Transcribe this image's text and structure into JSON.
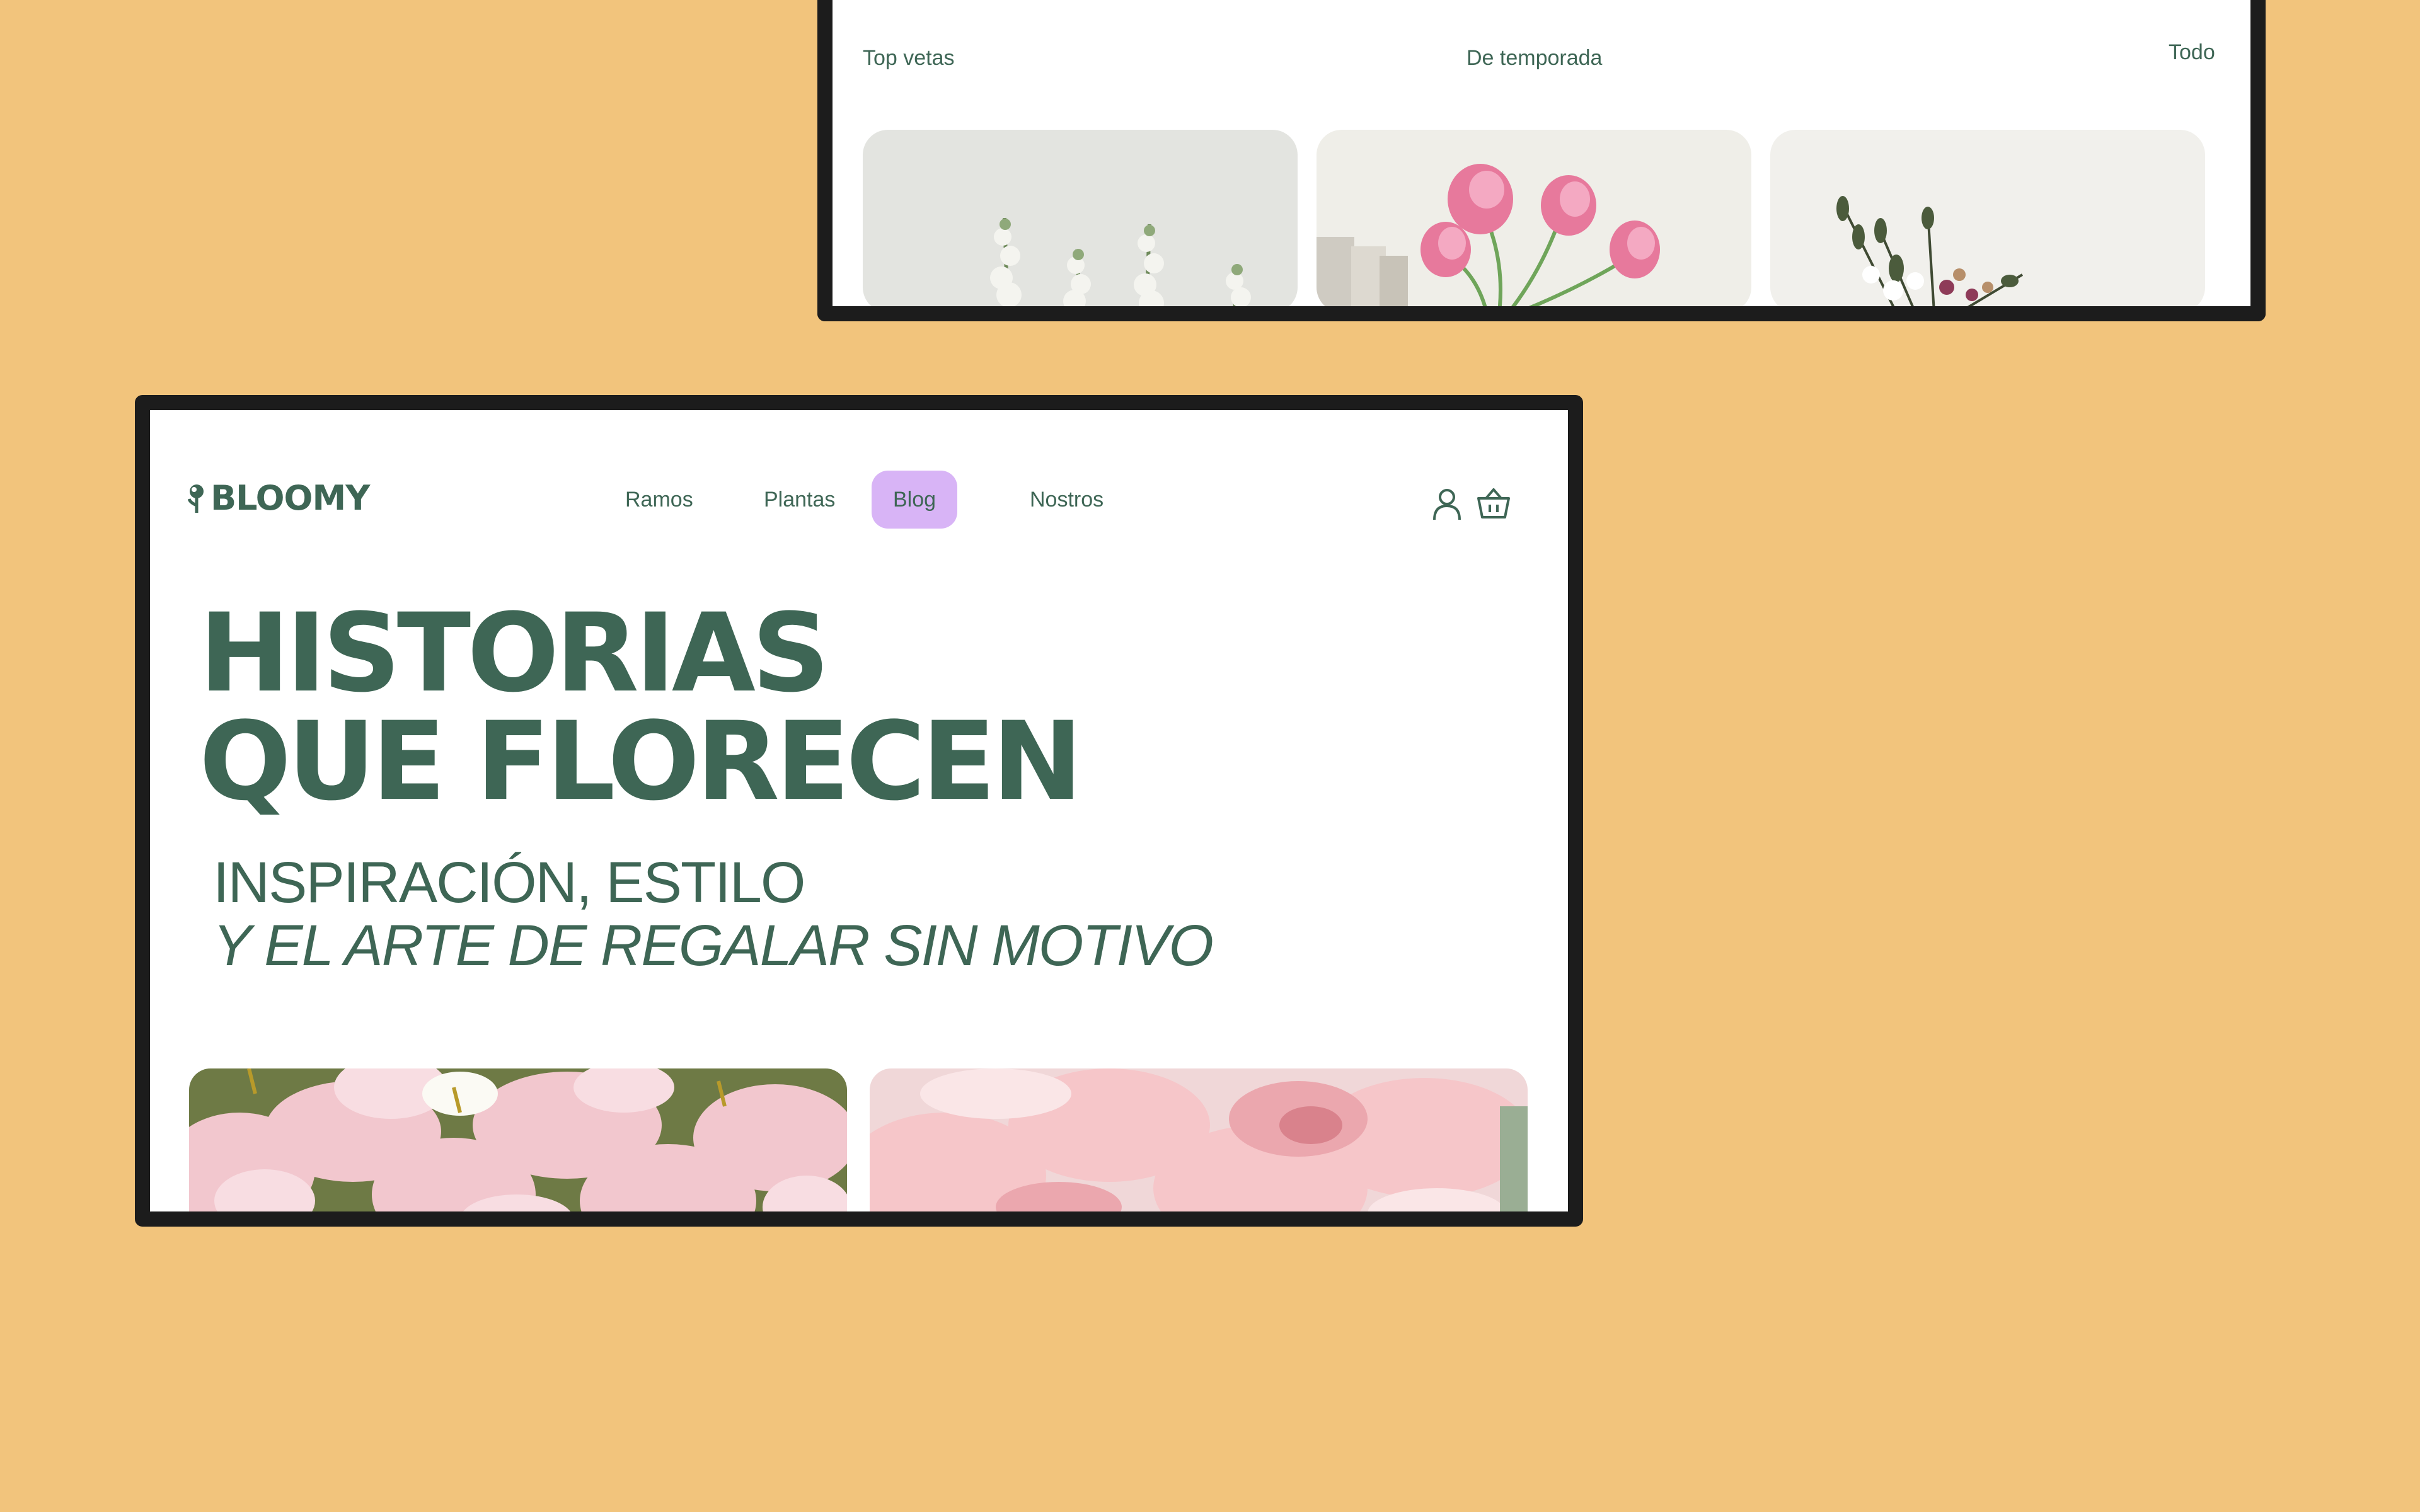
{
  "top_mock": {
    "filters": [
      "Top vetas",
      "De temporada"
    ],
    "view_all": "Todo",
    "cards": [
      {
        "name": "white-stock-flowers"
      },
      {
        "name": "pink-tulips-bouquet"
      },
      {
        "name": "dried-flowers-bouquet"
      }
    ]
  },
  "header": {
    "logo": "BLOOMY",
    "nav": [
      "Ramos",
      "Plantas",
      "Blog",
      "Nostros"
    ],
    "active_nav": "Blog",
    "icons": [
      "user-icon",
      "basket-icon"
    ]
  },
  "hero": {
    "headline_line1": "HISTORIAS",
    "headline_line2": "QUE FLORECEN",
    "subtitle_line1": "INSPIRACIÓN, ESTILO",
    "subtitle_line2": "Y EL ARTE DE REGALAR SIN MOTIVO"
  },
  "photos": [
    {
      "name": "pink-tulips-closeup"
    },
    {
      "name": "pink-carnation-closeup"
    }
  ],
  "colors": {
    "background": "#F2C47C",
    "brand_green": "#3E6655",
    "active_pill": "#D8B4F6",
    "frame": "#1C1C1C"
  }
}
